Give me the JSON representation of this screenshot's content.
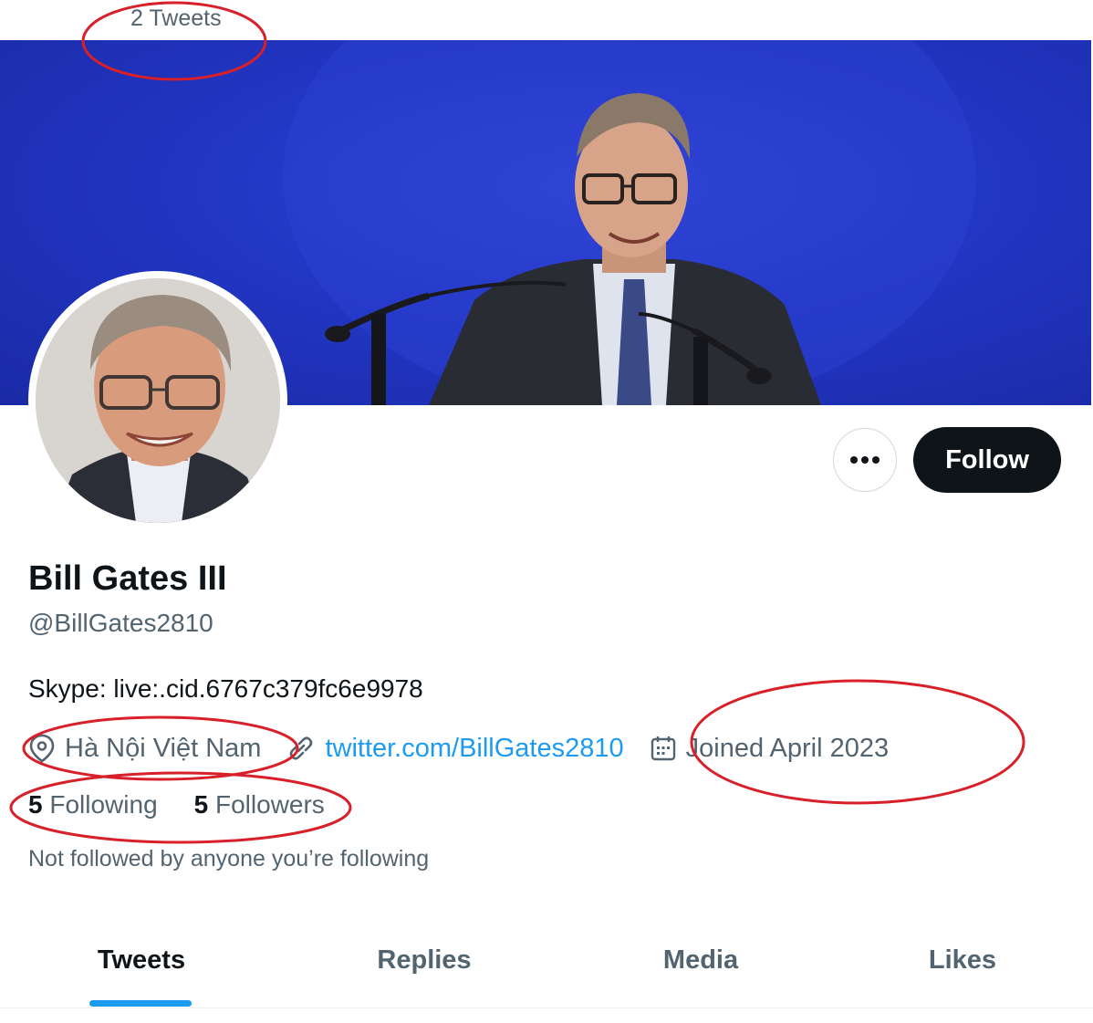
{
  "header": {
    "tweet_count": "2 Tweets"
  },
  "profile": {
    "display_name": "Bill Gates III",
    "handle": "@BillGates2810",
    "bio": "Skype: live:.cid.6767c379fc6e9978",
    "location": "Hà Nội Việt Nam",
    "website": "twitter.com/BillGates2810",
    "joined": "Joined April 2023",
    "following_count": "5",
    "following_label": "Following",
    "followers_count": "5",
    "followers_label": "Followers",
    "followed_by_note": "Not followed by anyone you’re following"
  },
  "actions": {
    "more_icon": "more-horizontal-icon",
    "follow_label": "Follow"
  },
  "tabs": [
    {
      "label": "Tweets",
      "active": true
    },
    {
      "label": "Replies",
      "active": false
    },
    {
      "label": "Media",
      "active": false
    },
    {
      "label": "Likes",
      "active": false
    }
  ],
  "icons": {
    "location": "map-pin-icon",
    "website": "link-icon",
    "joined": "calendar-icon"
  },
  "colors": {
    "accent": "#1d9bf0",
    "text_primary": "#0f1419",
    "text_secondary": "#536471",
    "banner_blue": "#2236c4",
    "annotation_red": "#d8202a"
  }
}
